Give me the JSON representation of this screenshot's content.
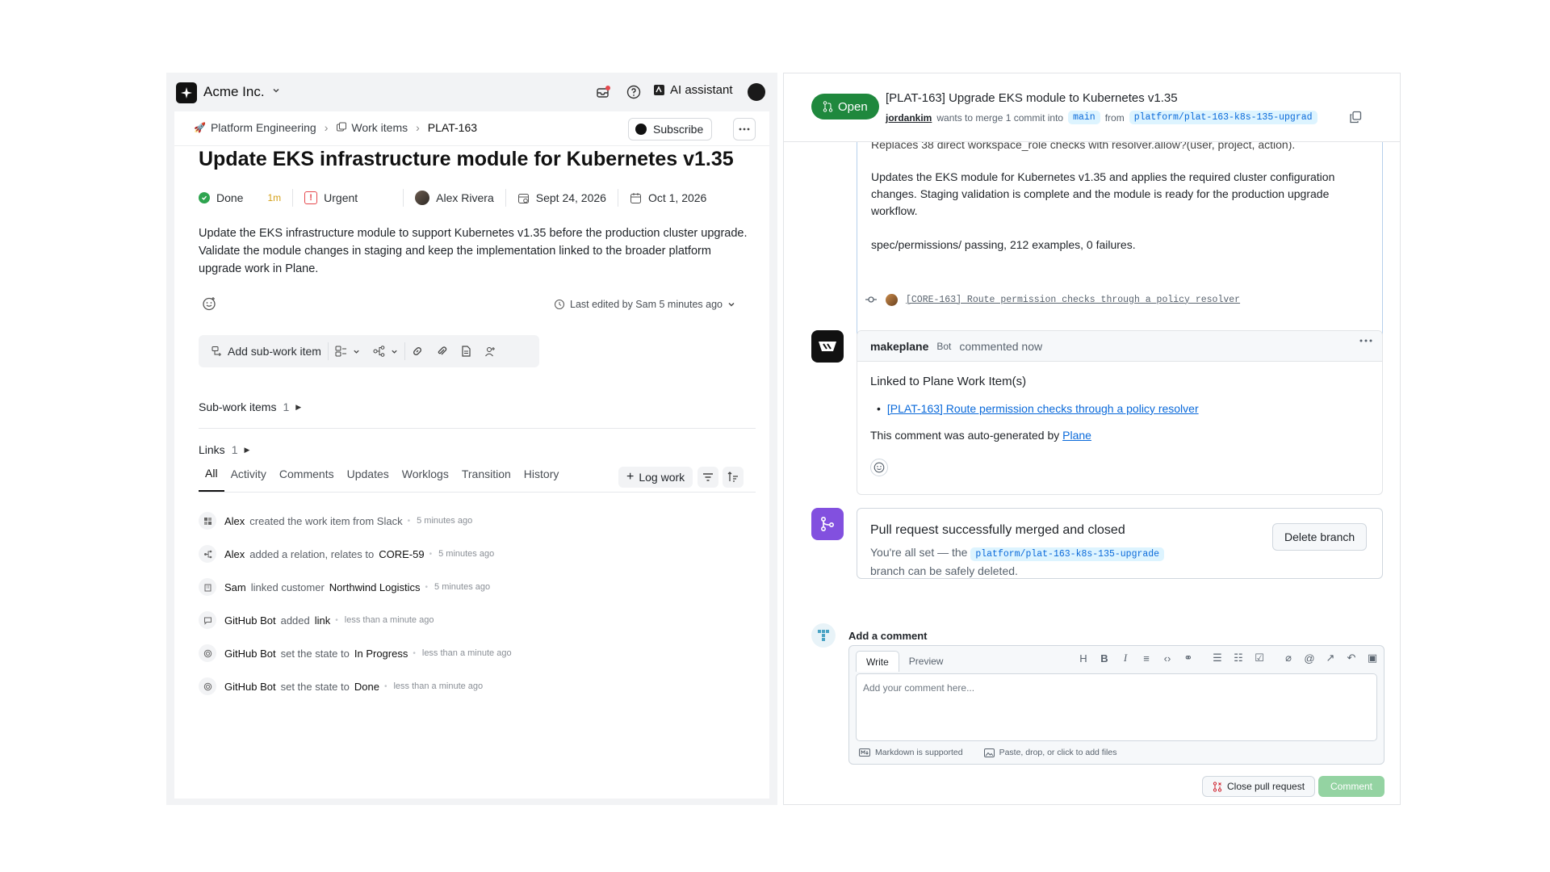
{
  "workspace": {
    "name": "Acme Inc."
  },
  "topbar": {
    "ai_label": "AI assistant"
  },
  "breadcrumb": {
    "project": "Platform Engineering",
    "section": "Work items",
    "current": "PLAT-163"
  },
  "actions": {
    "subscribe": "Subscribe"
  },
  "work_item": {
    "title": "Update EKS infrastructure module for Kubernetes v1.35",
    "state": "Done",
    "estimate": "1m",
    "priority": "Urgent",
    "assignee": "Alex Rivera",
    "start_date": "Sept 24, 2026",
    "due_date": "Oct 1, 2026",
    "description": "Update the EKS infrastructure module to support Kubernetes v1.35 before the production cluster upgrade. Validate the module changes in staging and keep the implementation linked to the broader platform upgrade work in Plane.",
    "last_edited": "Last edited by Sam 5 minutes ago"
  },
  "action_bar": {
    "add_sub": "Add sub-work item"
  },
  "sections": {
    "sub_items": {
      "label": "Sub-work items",
      "count": "1"
    },
    "links": {
      "label": "Links",
      "count": "1"
    }
  },
  "tabs": [
    "All",
    "Activity",
    "Comments",
    "Updates",
    "Worklogs",
    "Transition",
    "History"
  ],
  "log_work": "Log work",
  "activity": [
    {
      "actor": "Alex",
      "text": "created the work item from Slack",
      "strong": "",
      "time": "5 minutes ago"
    },
    {
      "actor": "Alex",
      "text": "added a relation, relates to",
      "strong": "CORE-59",
      "time": "5 minutes ago"
    },
    {
      "actor": "Sam",
      "text": "linked customer",
      "strong": "Northwind Logistics",
      "time": "5 minutes ago"
    },
    {
      "actor": "GitHub Bot",
      "text": "added",
      "strong": "link",
      "time": "less than a minute ago"
    },
    {
      "actor": "GitHub Bot",
      "text": "set the state to",
      "strong": "In Progress",
      "time": "less than a minute ago"
    },
    {
      "actor": "GitHub Bot",
      "text": "set the state to",
      "strong": "Done",
      "time": "less than a minute ago"
    }
  ],
  "pr": {
    "status": "Open",
    "title": "[PLAT-163] Upgrade EKS module to Kubernetes v1.35",
    "author": "jordankim",
    "merge_text": "wants to merge 1 commit into",
    "base": "main",
    "from_text": "from",
    "head": "platform/plat-163-k8s-135-upgrad",
    "body_cut": "Replaces 38 direct workspace_role checks with resolver.allow?(user, project, action).",
    "body_p1": "Updates the EKS module for Kubernetes v1.35 and applies the required cluster configuration changes. Staging validation is complete and the module is ready for the production upgrade workflow.",
    "body_p2": "spec/permissions/ passing, 212 examples, 0 failures.",
    "commit": "[CORE-163] Route permission checks through a policy resolver"
  },
  "bot_comment": {
    "author": "makeplane",
    "badge": "Bot",
    "when": "commented now",
    "heading": "Linked to Plane Work Item(s)",
    "link": "[PLAT-163] Route permission checks through a policy resolver",
    "footer_pre": "This comment was auto-generated by",
    "footer_link": "Plane"
  },
  "merge": {
    "title": "Pull request successfully merged and closed",
    "pre": "You're all set — the",
    "branch": "platform/plat-163-k8s-135-upgrade",
    "post": "branch can be safely deleted.",
    "delete_label": "Delete branch"
  },
  "composer": {
    "label": "Add a comment",
    "tab_write": "Write",
    "tab_preview": "Preview",
    "placeholder": "Add your comment here...",
    "markdown": "Markdown is supported",
    "files": "Paste, drop, or click to add files",
    "close_pr": "Close pull request",
    "comment": "Comment"
  },
  "colors": {
    "open_green": "#1f883d",
    "merge_purple": "#8250df",
    "done_green": "#2ea44f",
    "urgent_red": "#e5484d",
    "link_blue": "#0969da"
  }
}
